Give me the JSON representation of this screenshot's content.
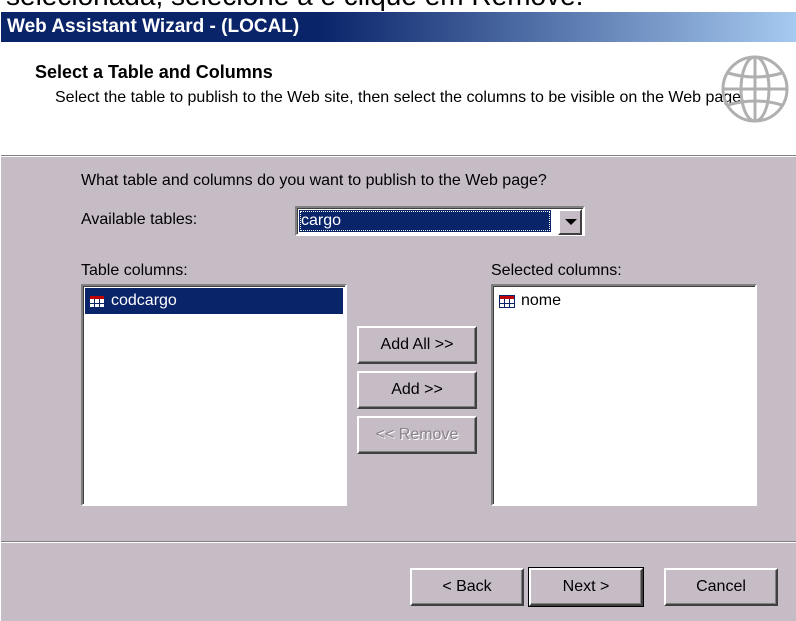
{
  "caption_fragment": "selecionada, selecione a e clique em Remove.",
  "window": {
    "title": "Web Assistant Wizard - (LOCAL)"
  },
  "header": {
    "title": "Select a Table and Columns",
    "description": "Select the table to publish to the Web site, then select the columns to be visible on the Web page."
  },
  "prompt": "What table and columns do you want to publish to the Web page?",
  "available_tables": {
    "label": "Available tables:",
    "value": "cargo"
  },
  "table_columns": {
    "label": "Table columns:",
    "items": [
      "codcargo"
    ]
  },
  "selected_columns": {
    "label": "Selected columns:",
    "items": [
      "nome"
    ]
  },
  "buttons": {
    "add_all": "Add All >>",
    "add": "Add >>",
    "remove": "<< Remove",
    "back": "< Back",
    "next": "Next >",
    "cancel": "Cancel"
  },
  "icons": {
    "header": "globe-icon",
    "column": "table-column-icon",
    "dropdown": "dropdown-arrow-icon"
  },
  "colors": {
    "selection": "#0a246a",
    "face": "#c6bcc6"
  }
}
